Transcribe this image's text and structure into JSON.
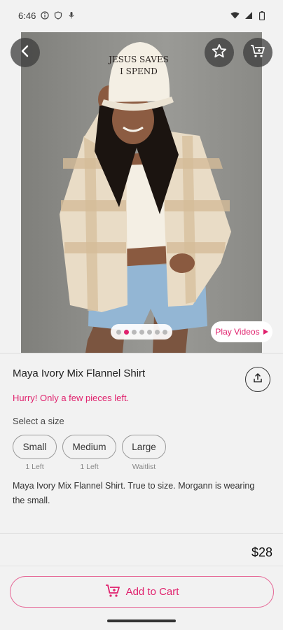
{
  "status_bar": {
    "time": "6:46",
    "icons_left": [
      "info-icon",
      "shield-icon",
      "mic-icon"
    ],
    "icons_right": [
      "wifi-icon",
      "signal-icon",
      "battery-icon"
    ]
  },
  "header": {
    "back_icon": "chevron-left-icon",
    "favorite_icon": "star-icon",
    "cart_icon": "cart-icon"
  },
  "gallery": {
    "dot_count": 7,
    "active_dot": 1,
    "play_videos_label": "Play Videos",
    "hat_text_line1": "JESUS SAVES",
    "hat_text_line2": "I SPEND"
  },
  "product": {
    "title": "Maya Ivory Mix Flannel Shirt",
    "hurry_text": "Hurry! Only a few pieces left.",
    "select_size_label": "Select a size",
    "sizes": [
      {
        "label": "Small",
        "availability": "1 Left"
      },
      {
        "label": "Medium",
        "availability": "1 Left"
      },
      {
        "label": "Large",
        "availability": "Waitlist"
      }
    ],
    "description": "Maya Ivory Mix Flannel Shirt. True to size. Morgann is wearing the small.",
    "price": "$28"
  },
  "footer": {
    "add_to_cart_label": "Add to Cart"
  },
  "colors": {
    "accent": "#e0216d",
    "background": "#f2f2f2"
  }
}
